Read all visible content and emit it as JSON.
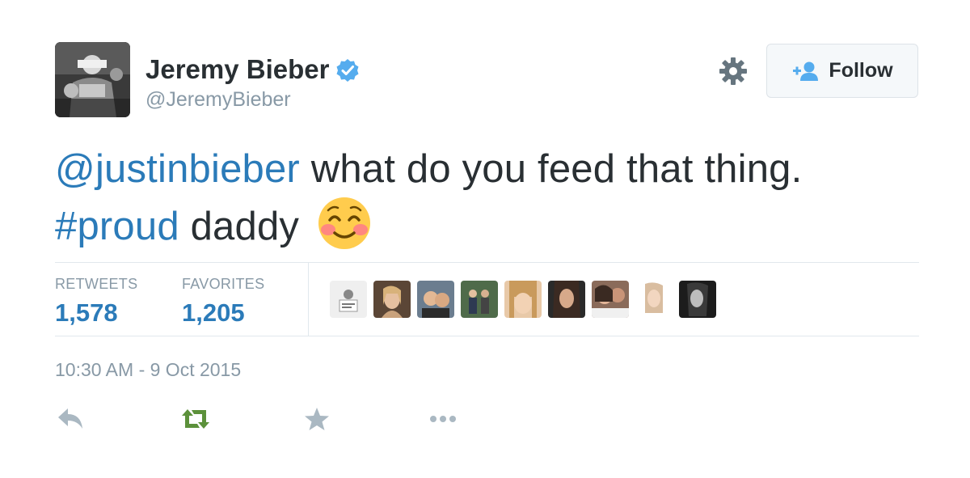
{
  "user": {
    "name": "Jeremy Bieber",
    "handle": "@JeremyBieber",
    "verified": true
  },
  "header": {
    "follow_label": "Follow",
    "settings_icon": "gear-icon",
    "follow_icon": "add-user-icon"
  },
  "tweet": {
    "mention": "@justinbieber",
    "text_part1": " what do you feed that thing.",
    "hashtag": "#proud",
    "text_part2": " daddy",
    "emoji": "smiling-face-with-blush-emoji"
  },
  "stats": {
    "retweets_label": "RETWEETS",
    "retweets_count": "1,578",
    "favorites_label": "FAVORITES",
    "favorites_count": "1,205"
  },
  "timestamp": "10:30 AM - 9 Oct 2015",
  "actions": [
    "reply-icon",
    "retweet-icon",
    "favorite-icon",
    "more-icon"
  ],
  "colors": {
    "link": "#2b7bb9",
    "text": "#292f33",
    "muted": "#8899a6",
    "verified": "#55acee",
    "retweet_active": "#5c913b",
    "action_gray": "#aab8c2"
  }
}
